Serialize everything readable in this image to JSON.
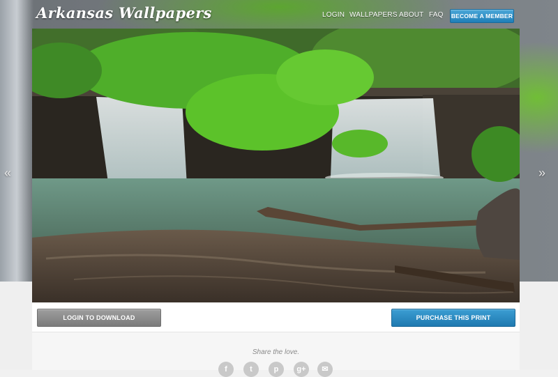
{
  "header": {
    "logo": "Arkansas Wallpapers",
    "nav": [
      "LOGIN",
      "WALLPAPERS",
      "ABOUT",
      "FAQ"
    ],
    "member_button": "BECOME A MEMBER"
  },
  "gallery": {
    "prev_arrow": "«",
    "next_arrow": "»"
  },
  "actions": {
    "download_button": "LOGIN TO DOWNLOAD",
    "purchase_button": "PURCHASE THIS PRINT"
  },
  "share": {
    "text": "Share the love.",
    "icons": [
      "facebook-icon",
      "twitter-icon",
      "pinterest-icon",
      "google-plus-icon",
      "email-icon"
    ],
    "glyphs": [
      "f",
      "t",
      "p",
      "g+",
      "✉"
    ]
  },
  "colors": {
    "accent_blue": "#2a8cc4",
    "gray_button": "#8a8a8a",
    "foliage_green": "#5cc22a"
  }
}
